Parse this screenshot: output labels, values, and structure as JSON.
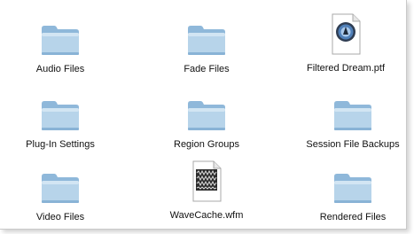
{
  "files": [
    {
      "name": "Audio Files",
      "kind": "folder-icon"
    },
    {
      "name": "Fade Files",
      "kind": "folder-icon"
    },
    {
      "name": "Filtered Dream.ptf",
      "kind": "session-document-icon",
      "badge": "SESSION"
    },
    {
      "name": "Plug-In Settings",
      "kind": "folder-icon"
    },
    {
      "name": "Region Groups",
      "kind": "folder-icon"
    },
    {
      "name": "Session File Backups",
      "kind": "folder-icon"
    },
    {
      "name": "Video Files",
      "kind": "folder-icon"
    },
    {
      "name": "WaveCache.wfm",
      "kind": "overview-document-icon",
      "badge": "OVERVIEW"
    },
    {
      "name": "Rendered Files",
      "kind": "folder-icon"
    }
  ],
  "colors": {
    "folder_light": "#cfe3f2",
    "folder_mid": "#a9cae4",
    "folder_dark": "#7fadd2",
    "window_bg": "#ffffff"
  }
}
